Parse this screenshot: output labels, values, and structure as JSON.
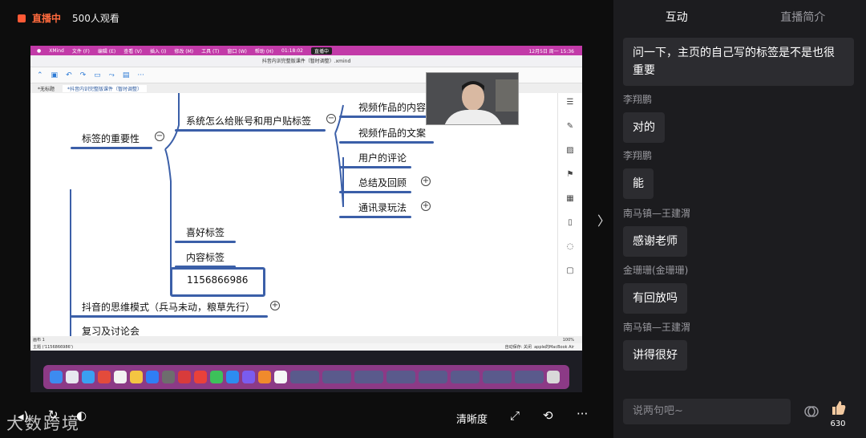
{
  "live": {
    "status": "直播中",
    "viewers": "500人观看"
  },
  "screen": {
    "mac_menu": [
      "XMind",
      "文件 (F)",
      "编辑 (E)",
      "查看 (V)",
      "插入 (I)",
      "修改 (M)",
      "工具 (T)",
      "窗口 (W)",
      "帮助 (H)"
    ],
    "rec_time": "01:18:02",
    "rec_label": "直播中",
    "clock": "12月5日 周一 15:36",
    "window_title": "抖音内训完整版课件（暂时调整）.xmind",
    "tabs": [
      "*无标题",
      "*抖音内训完整版课件（暂时调整）"
    ],
    "mindmap": {
      "root_label": "标签的重要性",
      "branch_label": "系统怎么给账号和用户贴标签",
      "children": [
        "视频作品的内容",
        "视频作品的文案",
        "用户的评论",
        "总结及回顾",
        "通讯录玩法"
      ],
      "sub1": "喜好标签",
      "sub2": "内容标签",
      "box": "1156866986",
      "topic2": "抖音的思维模式（兵马未动，粮草先行）",
      "topic3": "复习及讨论会"
    },
    "sheet": "画布 1",
    "status_topic": "主题 ('1156866986')",
    "zoom": "100%",
    "autosave": "自动保存: 关闭",
    "device": "apple的MacBook Air"
  },
  "controls": {
    "clarity": "清晰度"
  },
  "watermark": "大数跨境",
  "panel": {
    "tabs": [
      "互动",
      "直播简介"
    ],
    "messages": [
      {
        "name": "",
        "text": "问一下，主页的自己写的标签是不是也很重要"
      },
      {
        "name": "李翔鹏",
        "text": "对的"
      },
      {
        "name": "李翔鹏",
        "text": "能"
      },
      {
        "name": "南马镇—王建渭",
        "text": "感谢老师"
      },
      {
        "name": "金珊珊(金珊珊)",
        "text": "有回放吗"
      },
      {
        "name": "南马镇—王建渭",
        "text": "讲得很好"
      }
    ],
    "input_placeholder": "说两句吧~",
    "like_count": "630"
  },
  "colors": {
    "live": "#ff6a3d",
    "mac_bar": "#c23aa8",
    "mindmap_line": "#3b5fa8",
    "panel_bg": "#1c1c1f"
  }
}
